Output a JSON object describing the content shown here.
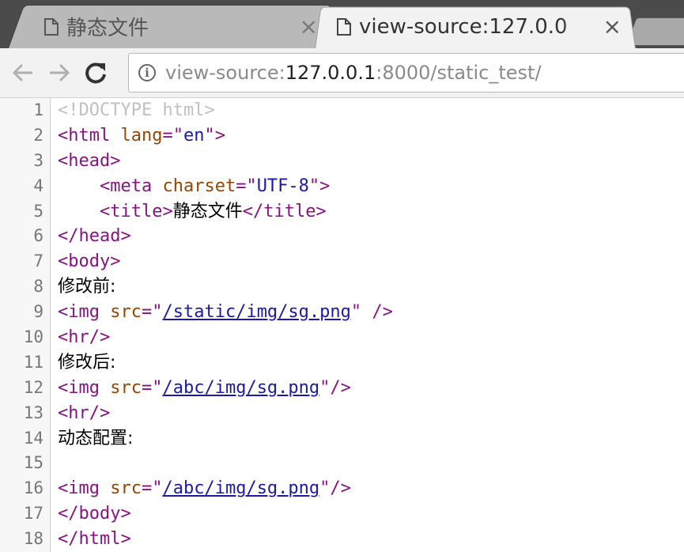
{
  "tabs": [
    {
      "title": "静态文件",
      "active": false
    },
    {
      "title": "view-source:127.0.0",
      "active": true
    }
  ],
  "tab_close_glyph": "×",
  "nav": {
    "back_icon": "arrow-left-icon",
    "forward_icon": "arrow-right-icon",
    "reload_icon": "reload-icon",
    "info_icon": "info-icon"
  },
  "url": {
    "prefix": "view-source:",
    "host": "127.0.0.1",
    "rest": ":8000/static_test/"
  },
  "colors": {
    "tag": "#881280",
    "attr": "#994500",
    "value": "#1a1aa6",
    "doctype": "#c0c0c0"
  },
  "source": {
    "lines": [
      {
        "num": "1",
        "parts": [
          {
            "t": "doctype",
            "s": "<!DOCTYPE html>"
          }
        ]
      },
      {
        "num": "2",
        "parts": [
          {
            "t": "tag",
            "s": "<html "
          },
          {
            "t": "attr",
            "s": "lang"
          },
          {
            "t": "tag",
            "s": "=\""
          },
          {
            "t": "val",
            "s": "en"
          },
          {
            "t": "tag",
            "s": "\">"
          }
        ]
      },
      {
        "num": "3",
        "parts": [
          {
            "t": "tag",
            "s": "<head>"
          }
        ]
      },
      {
        "num": "4",
        "parts": [
          {
            "t": "txt",
            "s": "    "
          },
          {
            "t": "tag",
            "s": "<meta "
          },
          {
            "t": "attr",
            "s": "charset"
          },
          {
            "t": "tag",
            "s": "=\""
          },
          {
            "t": "val",
            "s": "UTF-8"
          },
          {
            "t": "tag",
            "s": "\">"
          }
        ]
      },
      {
        "num": "5",
        "parts": [
          {
            "t": "txt",
            "s": "    "
          },
          {
            "t": "tag",
            "s": "<title>"
          },
          {
            "t": "cjk",
            "s": "静态文件"
          },
          {
            "t": "tag",
            "s": "</title>"
          }
        ]
      },
      {
        "num": "6",
        "parts": [
          {
            "t": "tag",
            "s": "</head>"
          }
        ]
      },
      {
        "num": "7",
        "parts": [
          {
            "t": "tag",
            "s": "<body>"
          }
        ]
      },
      {
        "num": "8",
        "parts": [
          {
            "t": "cjk",
            "s": "修改前:"
          }
        ]
      },
      {
        "num": "9",
        "parts": [
          {
            "t": "tag",
            "s": "<img "
          },
          {
            "t": "attr",
            "s": "src"
          },
          {
            "t": "tag",
            "s": "=\""
          },
          {
            "t": "link",
            "s": "/static/img/sg.png"
          },
          {
            "t": "tag",
            "s": "\" />"
          }
        ]
      },
      {
        "num": "10",
        "parts": [
          {
            "t": "tag",
            "s": "<hr/>"
          }
        ]
      },
      {
        "num": "11",
        "parts": [
          {
            "t": "cjk",
            "s": "修改后:"
          }
        ]
      },
      {
        "num": "12",
        "parts": [
          {
            "t": "tag",
            "s": "<img "
          },
          {
            "t": "attr",
            "s": "src"
          },
          {
            "t": "tag",
            "s": "=\""
          },
          {
            "t": "link",
            "s": "/abc/img/sg.png"
          },
          {
            "t": "tag",
            "s": "\"/>"
          }
        ]
      },
      {
        "num": "13",
        "parts": [
          {
            "t": "tag",
            "s": "<hr/>"
          }
        ]
      },
      {
        "num": "14",
        "parts": [
          {
            "t": "cjk",
            "s": "动态配置:"
          }
        ]
      },
      {
        "num": "15",
        "parts": []
      },
      {
        "num": "16",
        "parts": [
          {
            "t": "tag",
            "s": "<img "
          },
          {
            "t": "attr",
            "s": "src"
          },
          {
            "t": "tag",
            "s": "=\""
          },
          {
            "t": "link",
            "s": "/abc/img/sg.png"
          },
          {
            "t": "tag",
            "s": "\"/>"
          }
        ]
      },
      {
        "num": "17",
        "parts": [
          {
            "t": "tag",
            "s": "</body>"
          }
        ]
      },
      {
        "num": "18",
        "parts": [
          {
            "t": "tag",
            "s": "</html>"
          }
        ]
      }
    ]
  }
}
